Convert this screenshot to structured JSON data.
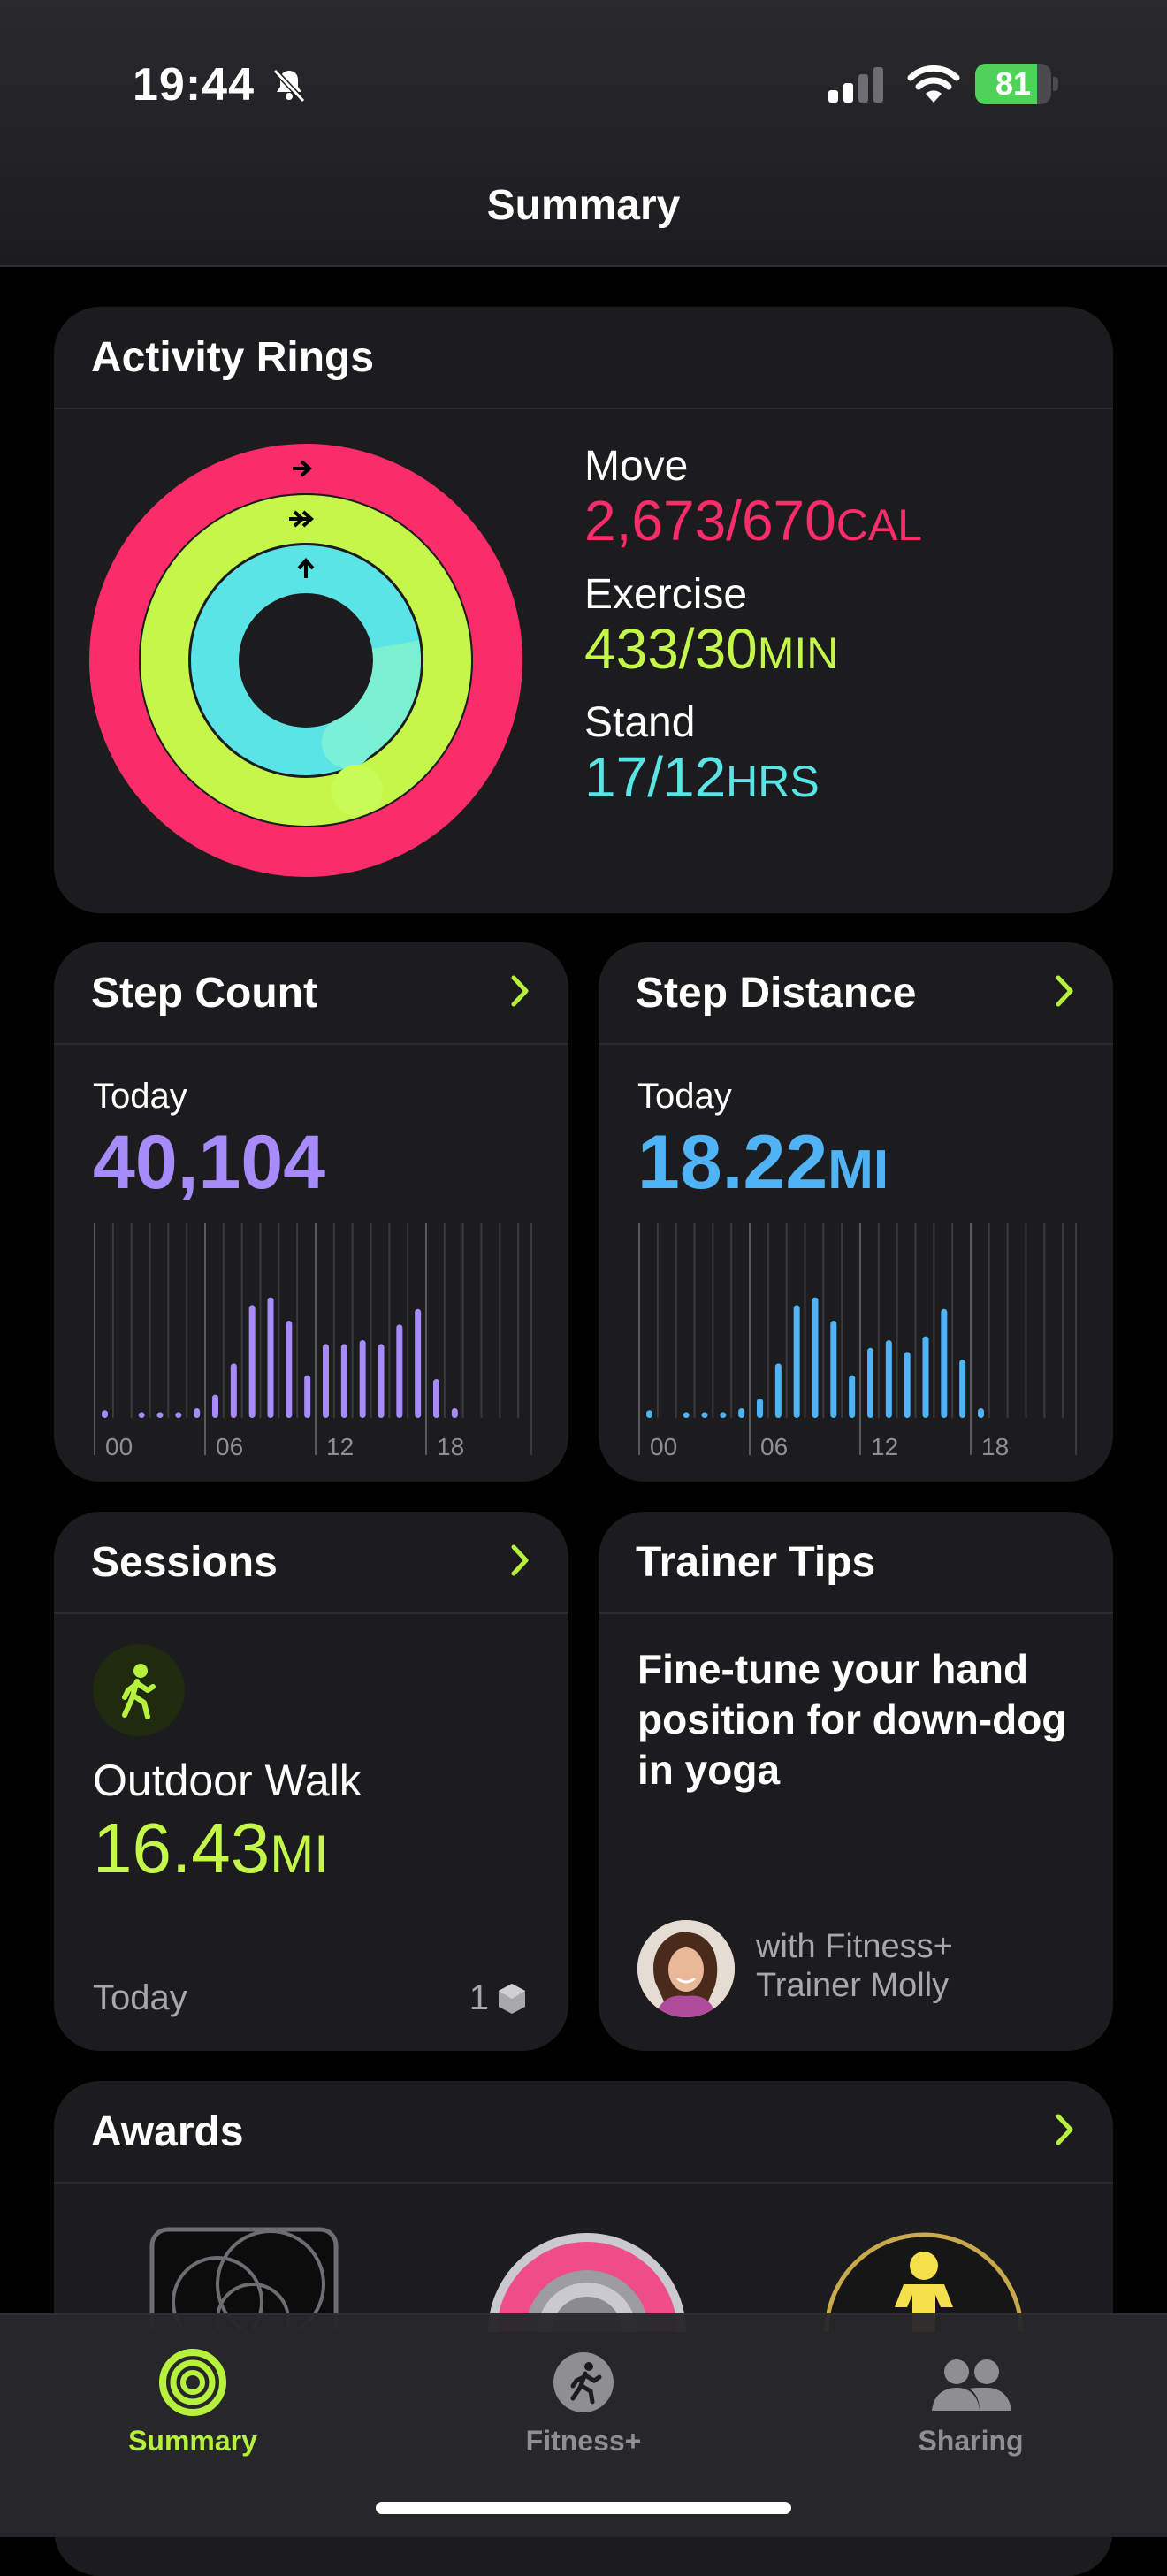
{
  "status_bar": {
    "time": "19:44",
    "battery": "81",
    "battery_level": 0.81
  },
  "nav": {
    "title": "Summary"
  },
  "activity": {
    "title": "Activity Rings",
    "move": {
      "label": "Move",
      "value": "2,673/670",
      "unit": "CAL",
      "color": "#fa2d6a"
    },
    "exercise": {
      "label": "Exercise",
      "value": "433/30",
      "unit": "MIN",
      "color": "#c4f74a"
    },
    "stand": {
      "label": "Stand",
      "value": "17/12",
      "unit": "HRS",
      "color": "#5be4e6"
    }
  },
  "steps": {
    "title": "Step Count",
    "period": "Today",
    "value": "40,104",
    "color": "#a78bfa",
    "hours": [
      0,
      0,
      0,
      0,
      0,
      0,
      1,
      2,
      6,
      10,
      7,
      3,
      5,
      6,
      6,
      6,
      8,
      4,
      0,
      0,
      0,
      0,
      0,
      0
    ],
    "levels": [
      0.04,
      0,
      0.03,
      0.03,
      0.03,
      0.05,
      0.12,
      0.28,
      0.58,
      0.62,
      0.5,
      0.22,
      0.38,
      0.38,
      0.4,
      0.38,
      0.48,
      0.56,
      0.2,
      0.05,
      0,
      0,
      0,
      0
    ],
    "ticks": [
      "00",
      "06",
      "12",
      "18"
    ]
  },
  "distance": {
    "title": "Step Distance",
    "period": "Today",
    "value": "18.22",
    "unit": "MI",
    "color": "#4fb3f6",
    "levels": [
      0.04,
      0,
      0.03,
      0.03,
      0.03,
      0.05,
      0.1,
      0.28,
      0.58,
      0.62,
      0.5,
      0.22,
      0.36,
      0.4,
      0.34,
      0.42,
      0.56,
      0.3,
      0.05,
      0,
      0,
      0,
      0,
      0
    ],
    "ticks": [
      "00",
      "06",
      "12",
      "18"
    ]
  },
  "sessions": {
    "title": "Sessions",
    "workout": "Outdoor Walk",
    "value": "16.43",
    "unit": "MI",
    "date": "Today",
    "count": "1"
  },
  "tips": {
    "title": "Trainer Tips",
    "tip": "Fine-tune your hand position for down-dog in yoga",
    "trainer": "with Fitness+ Trainer Molly"
  },
  "awards": {
    "title": "Awards"
  },
  "tabs": [
    {
      "label": "Summary",
      "icon": "activity-rings-icon",
      "active": true
    },
    {
      "label": "Fitness+",
      "icon": "fitness-plus-icon",
      "active": false
    },
    {
      "label": "Sharing",
      "icon": "sharing-icon",
      "active": false
    }
  ],
  "colors": {
    "accent": "#b6f23d",
    "card": "#1c1c1e"
  }
}
